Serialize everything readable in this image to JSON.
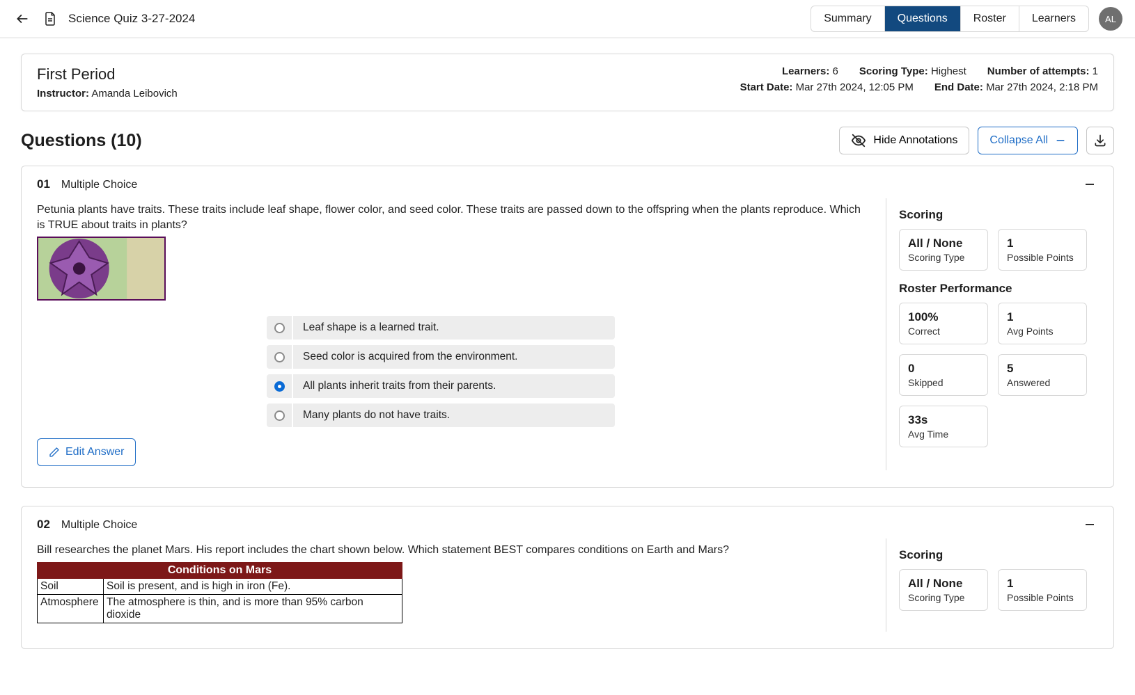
{
  "header": {
    "doc_title": "Science Quiz 3-27-2024",
    "tabs": [
      "Summary",
      "Questions",
      "Roster",
      "Learners"
    ],
    "active_tab": "Questions",
    "avatar_initials": "AL"
  },
  "info": {
    "period": "First Period",
    "instructor_label": "Instructor:",
    "instructor_name": "Amanda Leibovich",
    "learners_label": "Learners:",
    "learners_value": "6",
    "scoring_type_label": "Scoring Type:",
    "scoring_type_value": "Highest",
    "attempts_label": "Number of attempts:",
    "attempts_value": "1",
    "start_label": "Start Date:",
    "start_value": "Mar 27th 2024, 12:05 PM",
    "end_label": "End Date:",
    "end_value": "Mar 27th 2024, 2:18 PM"
  },
  "qsection": {
    "title": "Questions (10)",
    "hide_annotations": "Hide Annotations",
    "collapse_all": "Collapse All",
    "edit_answer": "Edit Answer"
  },
  "q1": {
    "num": "01",
    "type": "Multiple Choice",
    "prompt": "Petunia plants have traits. These traits include leaf shape, flower color, and seed color. These traits are passed down to the offspring when the plants reproduce. Which is TRUE about traits in plants?",
    "image_alt": "petunia-flower-image",
    "choices": [
      "Leaf shape is a learned trait.",
      "Seed color is acquired from the environment.",
      "All plants inherit traits from their parents.",
      "Many plants do not have traits."
    ],
    "correct_index": 2,
    "scoring": {
      "title": "Scoring",
      "type_value": "All / None",
      "type_label": "Scoring Type",
      "points_value": "1",
      "points_label": "Possible Points",
      "perf_title": "Roster Performance",
      "correct_value": "100%",
      "correct_label": "Correct",
      "avgpts_value": "1",
      "avgpts_label": "Avg Points",
      "skipped_value": "0",
      "skipped_label": "Skipped",
      "answered_value": "5",
      "answered_label": "Answered",
      "avgtime_value": "33s",
      "avgtime_label": "Avg Time"
    }
  },
  "q2": {
    "num": "02",
    "type": "Multiple Choice",
    "prompt": "Bill researches the planet Mars. His report includes the chart shown below. Which statement BEST compares conditions on Earth and Mars?",
    "table_title": "Conditions on Mars",
    "rows": [
      {
        "label": "Soil",
        "value": "Soil is present, and is high in iron (Fe)."
      },
      {
        "label": "Atmosphere",
        "value": "The atmosphere is thin, and is more than 95% carbon dioxide"
      }
    ],
    "scoring": {
      "title": "Scoring",
      "type_value": "All / None",
      "points_value": "1"
    }
  }
}
